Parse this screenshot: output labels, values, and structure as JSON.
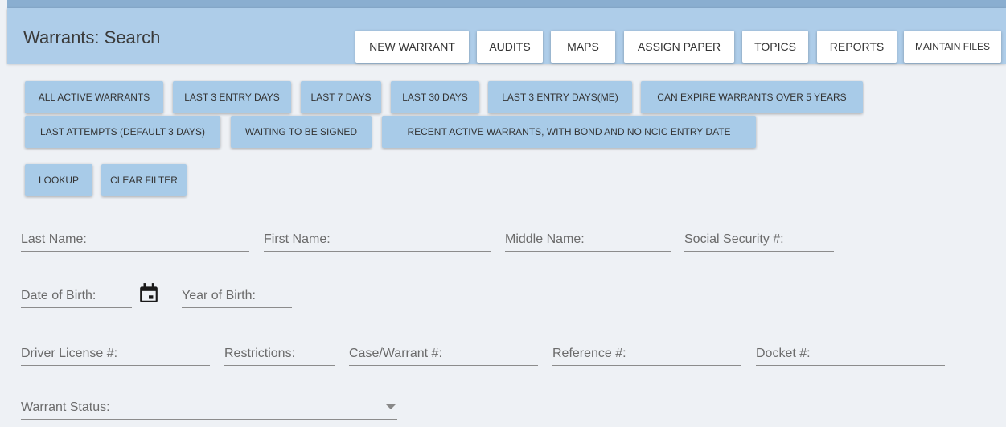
{
  "header": {
    "title": "Warrants: Search",
    "buttons": [
      "NEW WARRANT",
      "AUDITS",
      "MAPS",
      "ASSIGN PAPER",
      "TOPICS",
      "REPORTS",
      "MAINTAIN FILES"
    ]
  },
  "filters": {
    "row1": [
      "ALL ACTIVE WARRANTS",
      "LAST 3 ENTRY DAYS",
      "LAST 7 DAYS",
      "LAST 30 DAYS",
      "LAST 3 ENTRY DAYS(ME)",
      "CAN EXPIRE WARRANTS OVER 5 YEARS"
    ],
    "row2": [
      "LAST ATTEMPTS (DEFAULT 3 DAYS)",
      "WAITING TO BE SIGNED",
      "RECENT ACTIVE WARRANTS, WITH BOND AND NO NCIC ENTRY DATE"
    ],
    "lookup": "LOOKUP",
    "clear": "CLEAR FILTER"
  },
  "form": {
    "last_name": "Last Name:",
    "first_name": "First Name:",
    "middle_name": "Middle Name:",
    "ssn": "Social Security #:",
    "dob": "Date of Birth:",
    "yob": "Year of Birth:",
    "driver_license": "Driver License #:",
    "restrictions": "Restrictions:",
    "case_warrant": "Case/Warrant #:",
    "reference": "Reference #:",
    "docket": "Docket #:",
    "warrant_status": "Warrant Status:"
  },
  "icons": {
    "calendar": "calendar-icon",
    "dropdown": "chevron-down-icon"
  },
  "colors": {
    "header_bg": "#aecde9",
    "filter_button_bg": "#a8cbe8",
    "page_bg": "#eef1f5"
  }
}
